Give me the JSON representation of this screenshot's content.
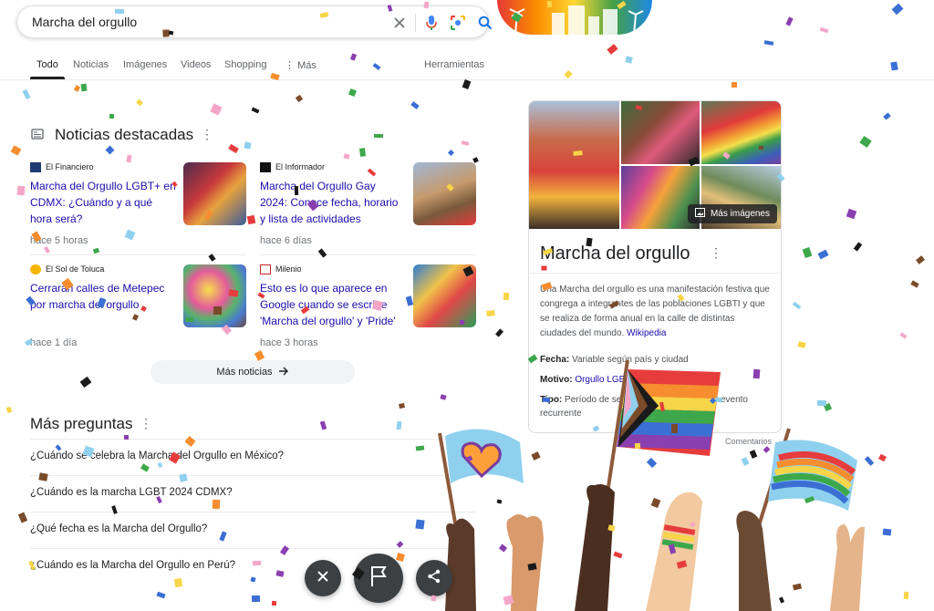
{
  "search": {
    "query": "Marcha del orgullo"
  },
  "tabs": [
    {
      "label": "Todo"
    },
    {
      "label": "Noticias"
    },
    {
      "label": "Imágenes"
    },
    {
      "label": "Videos"
    },
    {
      "label": "Shopping"
    },
    {
      "label": "Más"
    }
  ],
  "tools_label": "Herramientas",
  "news": {
    "title": "Noticias destacadas",
    "items": [
      {
        "source": "El Financiero",
        "headline": "Marcha del Orgullo LGBT+ en CDMX: ¿Cuándo y a qué hora será?",
        "time": "hace 5 horas"
      },
      {
        "source": "El Informador",
        "headline": "Marcha del Orgullo Gay 2024: Conoce fecha, horario y lista de actividades",
        "time": "hace 6 días"
      },
      {
        "source": "El Sol de Toluca",
        "headline": "Cerrarán calles de Metepec por marcha del orgullo",
        "time": "hace 1 día"
      },
      {
        "source": "Milenio",
        "headline": "Esto es lo que aparece en Google cuando se escribe 'Marcha del orgullo' y 'Pride'",
        "time": "hace 3 horas"
      }
    ],
    "more_label": "Más noticias"
  },
  "faq": {
    "title": "Más preguntas",
    "questions": [
      "¿Cuándo se celebra la Marcha del Orgullo en México?",
      "¿Cuándo es la marcha LGBT 2024 CDMX?",
      "¿Qué fecha es la Marcha del Orgullo?",
      "¿Cuándo es la Marcha del Orgullo en Perú?"
    ]
  },
  "panel": {
    "more_images_label": "Más imágenes",
    "title": "Marcha del orgullo",
    "description": "Una Marcha del orgullo es una manifestación festiva que congrega a integrantes de las poblaciones LGBTI y que se realiza de forma anual en la calle de distintas ciudades del mundo.",
    "source_link": "Wikipedia",
    "facts": [
      {
        "label": "Fecha:",
        "value": "Variable según país y ciudad"
      },
      {
        "label": "Motivo:",
        "value": "Orgullo LGBT"
      },
      {
        "label": "Tipo:",
        "value": "Período de sensibilización LGBTIA+ y evento recurrente"
      }
    ],
    "feedback_label": "Comentarios"
  },
  "colors": {
    "link": "#1a0dab",
    "accent": "#1a73e8",
    "fab": "#3c4043"
  },
  "icons": [
    "clear-icon",
    "mic-icon",
    "lens-icon",
    "search-icon",
    "newspaper-icon",
    "more-vert-icon",
    "arrow-right-icon",
    "image-icon",
    "close-icon",
    "flag-icon",
    "share-icon"
  ]
}
